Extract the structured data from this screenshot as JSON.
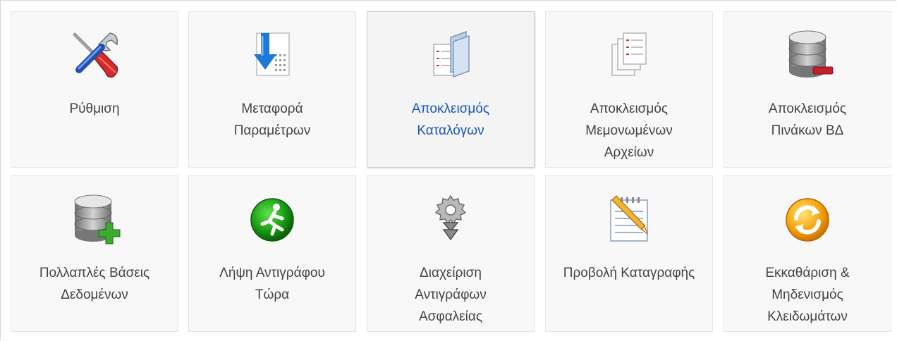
{
  "theme": {
    "label_color": "#444444",
    "active_label_color": "#1a56b8"
  },
  "tiles": [
    {
      "label_lines": [
        "Ρύθμιση"
      ],
      "icon": "tools-icon",
      "active": false
    },
    {
      "label_lines": [
        "Μεταφορά",
        "Παραμέτρων"
      ],
      "icon": "import-config-icon",
      "active": false
    },
    {
      "label_lines": [
        "Αποκλεισμός",
        "Καταλόγων"
      ],
      "icon": "folder-exclude-icon",
      "active": true
    },
    {
      "label_lines": [
        "Αποκλεισμός",
        "Μεμονωμένων",
        "Αρχείων"
      ],
      "icon": "files-exclude-icon",
      "active": false
    },
    {
      "label_lines": [
        "Αποκλεισμός",
        "Πινάκων ΒΔ"
      ],
      "icon": "database-exclude-icon",
      "active": false
    },
    {
      "label_lines": [
        "Πολλαπλές Βάσεις",
        "Δεδομένων"
      ],
      "icon": "database-add-icon",
      "active": false
    },
    {
      "label_lines": [
        "Λήψη Αντιγράφου",
        "Τώρα"
      ],
      "icon": "backup-now-icon",
      "active": false
    },
    {
      "label_lines": [
        "Διαχείριση",
        "Αντιγράφων",
        "Ασφαλείας"
      ],
      "icon": "manage-backups-icon",
      "active": false
    },
    {
      "label_lines": [
        "Προβολή Καταγραφής"
      ],
      "icon": "view-log-icon",
      "active": false
    },
    {
      "label_lines": [
        "Εκκαθάριση &",
        "Μηδενισμός",
        "Κλειδωμάτων"
      ],
      "icon": "unblock-reset-icon",
      "active": false
    }
  ]
}
